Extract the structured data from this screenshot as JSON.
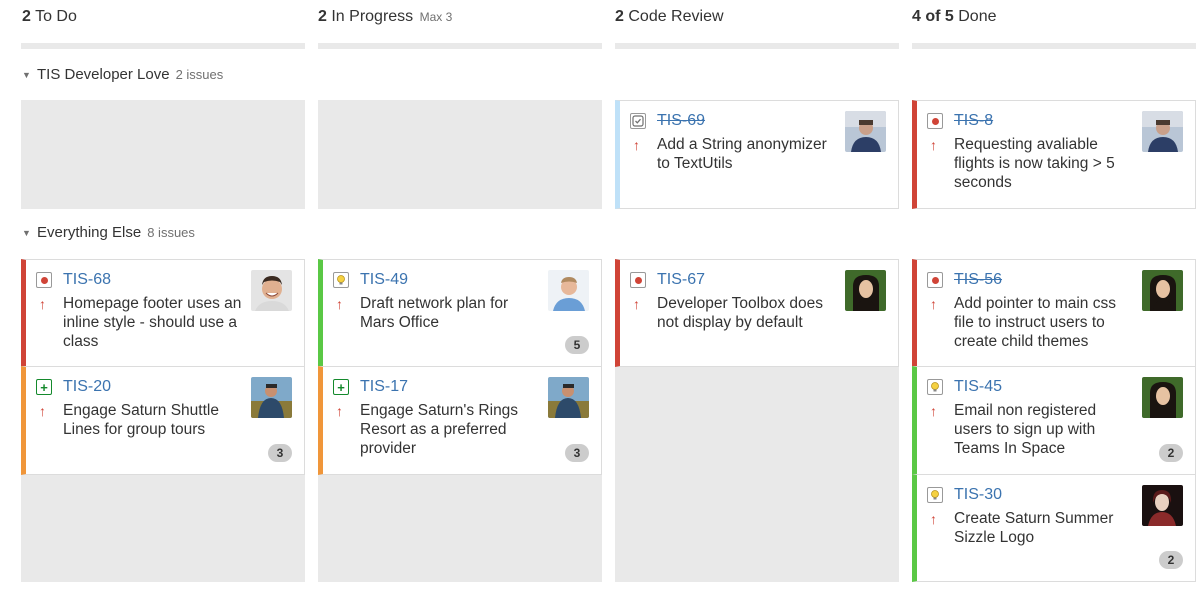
{
  "columns": [
    {
      "count": "2",
      "name": "To Do",
      "max": ""
    },
    {
      "count": "2",
      "name": "In Progress",
      "max": "Max 3"
    },
    {
      "count": "2",
      "name": "Code Review",
      "max": ""
    },
    {
      "count": "4 of 5",
      "name": "Done",
      "max": ""
    }
  ],
  "swimlanes": [
    {
      "title": "TIS Developer Love",
      "count": "2 issues"
    },
    {
      "title": "Everything Else",
      "count": "8 issues"
    }
  ],
  "cards": {
    "tis69": {
      "key": "TIS-69",
      "summary": "Add a String anonymizer to TextUtils",
      "type": "task-icon",
      "priority": "↑",
      "done": true
    },
    "tis8": {
      "key": "TIS-8",
      "summary": "Requesting avaliable flights is now taking > 5 seconds",
      "type": "bug-icon",
      "priority": "↑",
      "done": true
    },
    "tis68": {
      "key": "TIS-68",
      "summary": "Homepage footer uses an inline style - should use a class",
      "type": "bug-icon",
      "priority": "↑",
      "done": false
    },
    "tis20": {
      "key": "TIS-20",
      "summary": "Engage Saturn Shuttle Lines for group tours",
      "type": "story-icon",
      "priority": "↑",
      "points": "3",
      "done": false
    },
    "tis49": {
      "key": "TIS-49",
      "summary": "Draft network plan for Mars Office",
      "type": "idea-icon",
      "priority": "↑",
      "points": "5",
      "done": false
    },
    "tis17": {
      "key": "TIS-17",
      "summary": "Engage Saturn's Rings Resort as a preferred provider",
      "type": "story-icon",
      "priority": "↑",
      "points": "3",
      "done": false
    },
    "tis67": {
      "key": "TIS-67",
      "summary": "Developer Toolbox does not display by default",
      "type": "bug-icon",
      "priority": "↑",
      "done": false
    },
    "tis56": {
      "key": "TIS-56",
      "summary": "Add pointer to main css file to instruct users to create child themes",
      "type": "bug-icon",
      "priority": "↑",
      "done": true
    },
    "tis45": {
      "key": "TIS-45",
      "summary": "Email non registered users to sign up with Teams In Space",
      "type": "idea-icon",
      "priority": "↑",
      "points": "2",
      "done": false
    },
    "tis30": {
      "key": "TIS-30",
      "summary": "Create Saturn Summer Sizzle Logo",
      "type": "idea-icon",
      "priority": "↑",
      "points": "2",
      "done": false
    }
  },
  "icons": {
    "chevron": "chevron-down-icon",
    "priority": "priority-high-arrow-icon"
  },
  "colors": {
    "link": "#3b73af",
    "bug": "#d04437",
    "story": "#14892c",
    "lane_red": "#d04437",
    "lane_orange": "#f0963a",
    "lane_green": "#5ac845",
    "lane_blue": "#bfe1f8",
    "column_bg": "#e9e9e9"
  }
}
